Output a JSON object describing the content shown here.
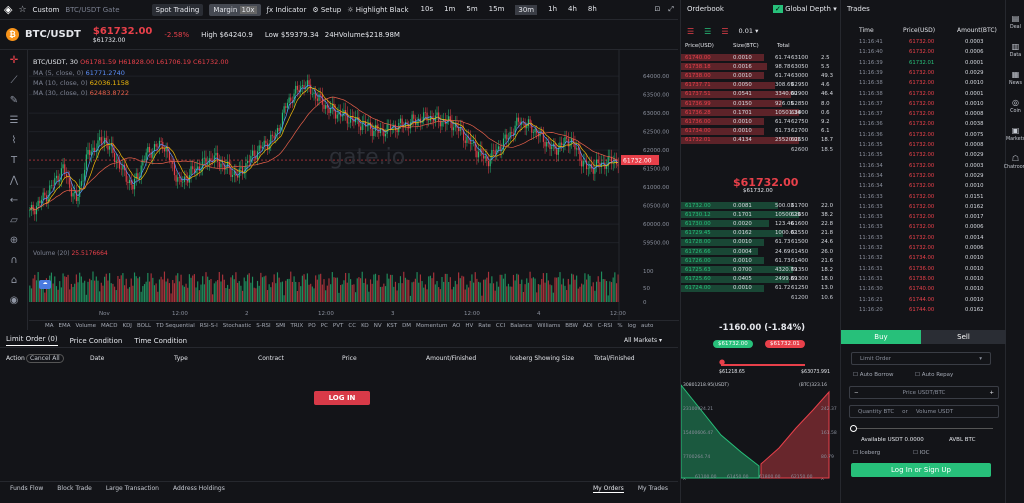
{
  "topbar": {
    "custom": "Custom",
    "pair_name": "BTC/USDT Gate",
    "spot": "Spot Trading",
    "margin": "Margin",
    "leverage": "10x",
    "indicator": "Indicator",
    "setup": "Setup",
    "highlight": "Highlight Black",
    "intervals": [
      "10s",
      "1m",
      "5m",
      "15m",
      "30m",
      "1h",
      "4h",
      "8h"
    ],
    "active_interval": "30m"
  },
  "ticker": {
    "symbol": "BTC/USDT",
    "price": "$61732.00",
    "price_sub": "$61732.00",
    "change": "-2.58%",
    "high_label": "High",
    "high": "$64240.9",
    "low_label": "Low",
    "low": "$59379.34",
    "vol_label": "24HVolume",
    "vol": "$218.98M"
  },
  "legend": {
    "title": "BTC/USDT, 30",
    "o": "O61781.59",
    "h": "H61828.00",
    "l": "L61706.19",
    "c": "C61732.00",
    "ma5": "MA (5, close, 0)",
    "ma5v": "61771.2740",
    "ma10": "MA (10, close, 0)",
    "ma10v": "62036.1158",
    "ma30": "MA (30, close, 0)",
    "ma30v": "62483.8722",
    "volume": "Volume (20)",
    "volume_v": "25.5176664",
    "watermark": "gate.io",
    "last_tag": "61732.00"
  },
  "chart_data": {
    "type": "candlestick",
    "yticks": [
      "64000.00",
      "63500.00",
      "63000.00",
      "62500.00",
      "62000.00",
      "61500.00",
      "61000.00",
      "60500.00",
      "60000.00",
      "59500.00"
    ],
    "xticks": [
      "Nov",
      "12:00",
      "2",
      "12:00",
      "3",
      "12:00",
      "4",
      "12:00"
    ],
    "vol_ticks": [
      "100",
      "50",
      "0"
    ],
    "ylim": [
      59300,
      64300
    ]
  },
  "indicators": [
    "MA",
    "EMA",
    "Volume",
    "MACD",
    "KDJ",
    "BOLL",
    "TD Sequential",
    "RSI-S-I",
    "Stochastic",
    "S-RSI",
    "SMI",
    "TRIX",
    "PO",
    "PC",
    "PVT",
    "CC",
    "KO",
    "NV",
    "KST",
    "DM",
    "Momentum",
    "AO",
    "HV",
    "Rate",
    "CCI",
    "Balance",
    "Williams",
    "BBW",
    "ADI",
    "C-RSI",
    "%",
    "log",
    "auto"
  ],
  "orders": {
    "tabs": [
      "Limit Order (0)",
      "Price Condition",
      "Time Condition"
    ],
    "all_markets": "All Markets",
    "cancel_all": "Cancel All",
    "columns": [
      "Action",
      "Date",
      "Type",
      "Contract",
      "Price",
      "Amount/Finished",
      "Iceberg Showing Size",
      "Total/Finished"
    ],
    "login": "LOG IN"
  },
  "bottom": {
    "left": [
      "Funds Flow",
      "Block Trade",
      "Large Transaction",
      "Address Holdings"
    ],
    "right": [
      "My Orders",
      "My Trades"
    ]
  },
  "orderbook": {
    "title": "Orderbook",
    "global_depth": "Global Depth",
    "precision": "0.01",
    "cols": [
      "Price(USD)",
      "Size(BTC)",
      "Total"
    ],
    "asks": [
      [
        "61740.00",
        "0.0010",
        "61.74",
        "63100",
        "2.5"
      ],
      [
        "61738.18",
        "0.0016",
        "98.78",
        "63050",
        "5.5"
      ],
      [
        "61738.00",
        "0.0010",
        "61.74",
        "63000",
        "49.3"
      ],
      [
        "61737.71",
        "0.0050",
        "308.69",
        "62950",
        "4.6"
      ],
      [
        "61737.51",
        "0.0541",
        "3340.00",
        "62900",
        "46.4"
      ],
      [
        "61736.99",
        "0.0150",
        "926.05",
        "62850",
        "8.0"
      ],
      [
        "61736.28",
        "0.1701",
        "10501.34",
        "62800",
        "0.6"
      ],
      [
        "61736.00",
        "0.0010",
        "61.74",
        "62750",
        "9.2"
      ],
      [
        "61734.00",
        "0.0010",
        "61.73",
        "62700",
        "6.1"
      ],
      [
        "61732.01",
        "0.4134",
        "25520.01",
        "62650",
        "18.7"
      ]
    ],
    "asks_tail": [
      "62600",
      "18.5"
    ],
    "mid": "$61732.00",
    "mid_sub": "$61732.00",
    "bids": [
      [
        "61732.00",
        "0.0081",
        "500.03",
        "61700",
        "22.0"
      ],
      [
        "61730.12",
        "0.1701",
        "10500.29",
        "61650",
        "38.2"
      ],
      [
        "61730.00",
        "0.0020",
        "123.46",
        "61600",
        "22.8"
      ],
      [
        "61729.45",
        "0.0162",
        "1000.02",
        "61550",
        "21.8"
      ],
      [
        "61728.00",
        "0.0010",
        "61.73",
        "61500",
        "24.6"
      ],
      [
        "61726.66",
        "0.0004",
        "24.69",
        "61450",
        "26.0"
      ],
      [
        "61726.00",
        "0.0010",
        "61.73",
        "61400",
        "21.6"
      ],
      [
        "61725.63",
        "0.0700",
        "4320.79",
        "61350",
        "18.2"
      ],
      [
        "61725.60",
        "0.0405",
        "2499.89",
        "61300",
        "18.0"
      ],
      [
        "61724.00",
        "0.0010",
        "61.72",
        "61250",
        "13.0"
      ]
    ],
    "bids_tail": [
      "61200",
      "10.6"
    ],
    "spread": "-1160.00",
    "spread_pct": "(-1.84%)",
    "bid_tag": "$61732.00",
    "ask_tag": "$61732.01",
    "range_low": "$61218.65",
    "range_high": "$63073.991",
    "depth_left": "30801218.95(USDT)",
    "depth_right": "(BTC)323.16",
    "depth_y": [
      "23100924.21",
      "15400606.47",
      "7700264.74",
      "0"
    ],
    "depth_y_right": [
      "242.37",
      "161.58",
      "80.79",
      "0"
    ],
    "depth_x": [
      "61100.00",
      "61450.00",
      "61800.00",
      "62150.00"
    ]
  },
  "trades": {
    "title": "Trades",
    "cols": [
      "Time",
      "Price(USD)",
      "Amount(BTC)"
    ],
    "rows": [
      [
        "11:16:41",
        "61732.00",
        "0.0003",
        "r"
      ],
      [
        "11:16:40",
        "61732.00",
        "0.0006",
        "r"
      ],
      [
        "11:16:39",
        "61732.01",
        "0.0001",
        "g"
      ],
      [
        "11:16:39",
        "61732.00",
        "0.0029",
        "r"
      ],
      [
        "11:16:38",
        "61732.00",
        "0.0010",
        "r"
      ],
      [
        "11:16:38",
        "61732.00",
        "0.0001",
        "r"
      ],
      [
        "11:16:37",
        "61732.00",
        "0.0010",
        "r"
      ],
      [
        "11:16:37",
        "61732.00",
        "0.0008",
        "r"
      ],
      [
        "11:16:36",
        "61732.00",
        "0.0038",
        "r"
      ],
      [
        "11:16:36",
        "61732.00",
        "0.0075",
        "r"
      ],
      [
        "11:16:35",
        "61732.00",
        "0.0008",
        "r"
      ],
      [
        "11:16:35",
        "61732.00",
        "0.0029",
        "r"
      ],
      [
        "11:16:34",
        "61732.00",
        "0.0003",
        "r"
      ],
      [
        "11:16:34",
        "61732.00",
        "0.0029",
        "r"
      ],
      [
        "11:16:34",
        "61732.00",
        "0.0010",
        "r"
      ],
      [
        "11:16:33",
        "61732.00",
        "0.0151",
        "r"
      ],
      [
        "11:16:33",
        "61732.00",
        "0.0162",
        "r"
      ],
      [
        "11:16:33",
        "61732.00",
        "0.0017",
        "r"
      ],
      [
        "11:16:33",
        "61732.00",
        "0.0006",
        "r"
      ],
      [
        "11:16:33",
        "61732.00",
        "0.0014",
        "r"
      ],
      [
        "11:16:32",
        "61732.00",
        "0.0006",
        "r"
      ],
      [
        "11:16:32",
        "61734.00",
        "0.0010",
        "r"
      ],
      [
        "11:16:31",
        "61736.00",
        "0.0010",
        "r"
      ],
      [
        "11:16:31",
        "61738.00",
        "0.0010",
        "r"
      ],
      [
        "11:16:30",
        "61740.00",
        "0.0010",
        "r"
      ],
      [
        "11:16:21",
        "61744.00",
        "0.0010",
        "r"
      ],
      [
        "11:16:20",
        "61744.00",
        "0.0162",
        "r"
      ]
    ]
  },
  "rail": [
    "Deal",
    "Data",
    "News",
    "Coin",
    "Markets",
    "Chatroom"
  ],
  "tradepanel": {
    "buy": "Buy",
    "sell": "Sell",
    "order_type": "Limit Order",
    "auto_borrow": "Auto Borrow",
    "auto_repay": "Auto Repay",
    "price_ph": "Price USDT/BTC",
    "qty_ph": "Quantity BTC",
    "or": "or",
    "vol_ph": "Volume USDT",
    "avail_label": "Available USDT",
    "avail": "0.0000",
    "avbl": "AVBL BTC",
    "iceberg": "Iceberg",
    "ioc": "IOC",
    "login": "Log In",
    "signup": "Sign Up"
  }
}
